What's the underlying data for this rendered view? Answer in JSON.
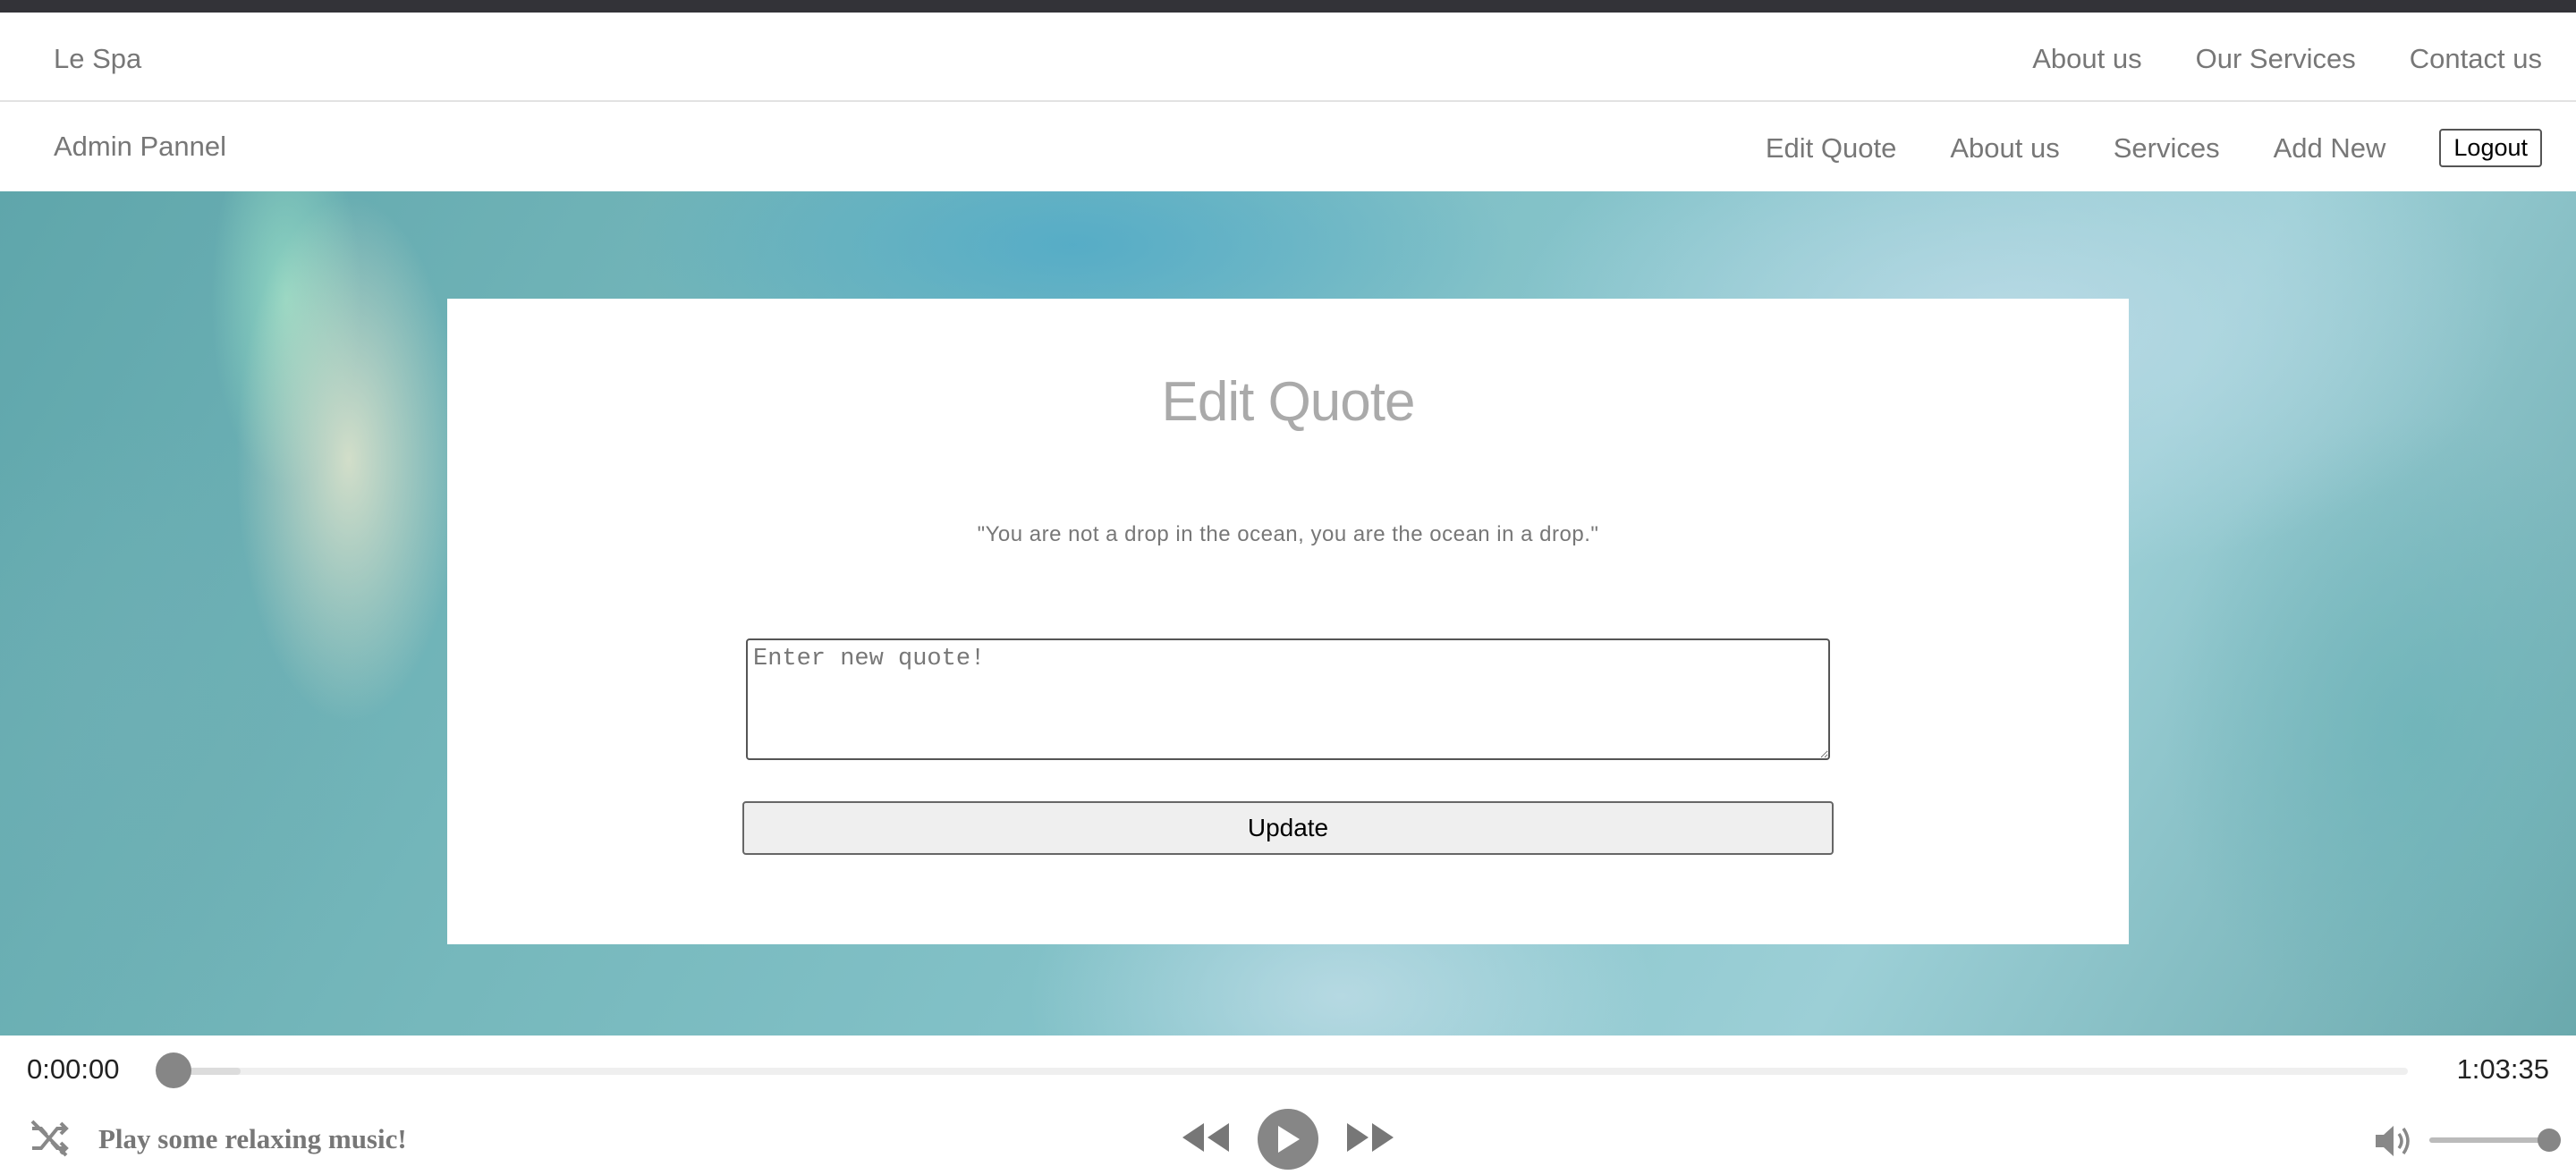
{
  "site_nav": {
    "brand": "Le Spa",
    "links": [
      "About us",
      "Our Services",
      "Contact us"
    ]
  },
  "admin_nav": {
    "brand": "Admin Pannel",
    "links": [
      "Edit Quote",
      "About us",
      "Services",
      "Add New"
    ],
    "logout_label": "Logout"
  },
  "card": {
    "title": "Edit Quote",
    "current_quote": "\"You are not a drop in the ocean, you are the ocean in a drop.\"",
    "input_placeholder": "Enter new quote!",
    "input_value": "",
    "update_label": "Update"
  },
  "player": {
    "current_time": "0:00:00",
    "total_time": "1:03:35",
    "progress": 0.0,
    "buffered": 0.03,
    "track_title": "Play some relaxing music!",
    "volume": 1.0,
    "icons": {
      "shuffle": "shuffle-off-icon",
      "rewind": "rewind-icon",
      "play": "play-icon",
      "forward": "fast-forward-icon",
      "volume": "volume-icon"
    }
  },
  "colors": {
    "top_bar": "#333338",
    "nav_text": "#777777",
    "control_gray": "#868686"
  }
}
